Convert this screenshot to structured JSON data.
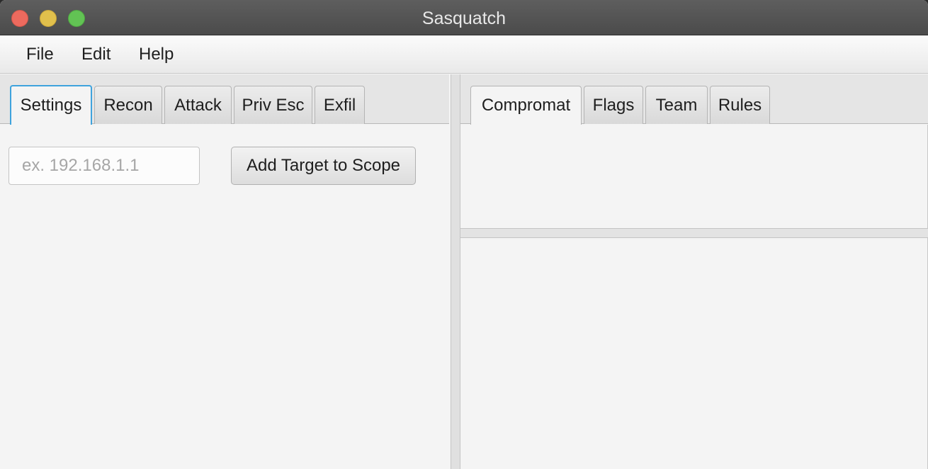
{
  "window": {
    "title": "Sasquatch"
  },
  "menubar": {
    "items": [
      "File",
      "Edit",
      "Help"
    ]
  },
  "left_tabs": {
    "items": [
      "Settings",
      "Recon",
      "Attack",
      "Priv Esc",
      "Exfil"
    ],
    "selected": "Settings"
  },
  "settings": {
    "target_input": {
      "value": "",
      "placeholder": "ex. 192.168.1.1"
    },
    "add_button_label": "Add Target to Scope"
  },
  "right_tabs": {
    "items": [
      "Compromat",
      "Flags",
      "Team",
      "Rules"
    ],
    "selected": "Compromat"
  },
  "colors": {
    "title_bar": "#555555",
    "focus_accent": "#3fa3dd",
    "close": "#ed6a5e",
    "minimize": "#e1c04c",
    "zoom": "#62c354"
  }
}
